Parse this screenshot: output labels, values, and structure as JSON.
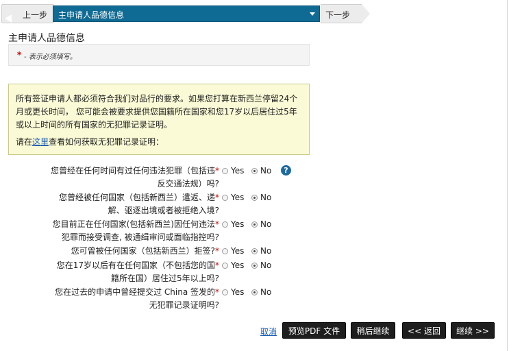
{
  "nav": {
    "prev_label": "上一步",
    "section_select_value": "主申请人品德信息",
    "next_label": "下一步"
  },
  "page_title": "主申请人品德信息",
  "required_note": {
    "star": "*",
    "text": "- 表示必须填写。"
  },
  "notice": {
    "paragraph1": "所有签证申请人都必须符合我们对品行的要求。如果您打算在新西兰停留24个月或更长时间， 您可能会被要求提供您国籍所在国家和您17岁以后居住过5年或以上时间的所有国家的无犯罪记录证明。",
    "p2_before": "请在",
    "p2_link": "这里",
    "p2_after": "查看如何获取无犯罪记录证明："
  },
  "questions": [
    {
      "line1": "您曾经在任何时间有过任何违法犯罪（包括违",
      "line2": "反交通法规）吗?",
      "yes": "Yes",
      "no": "No",
      "selected": "No",
      "has_help": true
    },
    {
      "line1": "您曾经被任何国家（包括新西兰）遣返、递",
      "line2": "解、驱逐出境或者被拒绝入境?",
      "yes": "Yes",
      "no": "No",
      "selected": "No",
      "has_help": false
    },
    {
      "line1": "您目前正在任何国家(包括新西兰)因任何违法",
      "line2": "犯罪而接受调查, 被通缉审问或面临指控吗?",
      "yes": "Yes",
      "no": "No",
      "selected": "No",
      "has_help": false
    },
    {
      "line1": "您可曾被任何国家（包括新西兰）拒签?",
      "line2": "",
      "yes": "Yes",
      "no": "No",
      "selected": "No",
      "has_help": false
    },
    {
      "line1": "您在17岁以后有在任何国家（不包括您的国",
      "line2": "籍所在国）居住过5年以上吗?",
      "yes": "Yes",
      "no": "No",
      "selected": "No",
      "has_help": false
    },
    {
      "line1": "您在过去的申请中曾经提交过 China 签发的",
      "line2": "无犯罪记录证明吗?",
      "yes": "Yes",
      "no": "No",
      "selected": "No",
      "has_help": false
    }
  ],
  "required_marker": "*",
  "help_icon_glyph": "?",
  "footer": {
    "cancel_label": "取消",
    "preview_pdf_label": "预览PDF 文件",
    "save_later_label": "稍后继续",
    "back_label": "<< 返回",
    "continue_label": "继续 >>"
  },
  "colors": {
    "select_bar": "#0f6b93",
    "notice_bg": "#fafad6",
    "required": "#d10000",
    "link": "#1a5fb4",
    "button_bg": "#1e1e1e"
  }
}
